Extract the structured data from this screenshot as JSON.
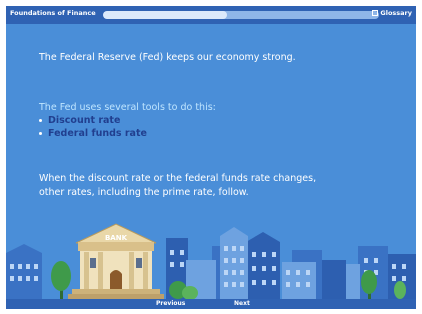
{
  "header": {
    "app_title": "Foundations of Finance",
    "glossary_label": "Glossary",
    "progress_percent": 45
  },
  "lesson": {
    "intro": "The Federal Reserve (Fed) keeps our economy strong.",
    "tools_intro": "The Fed uses several tools to do this:",
    "tools": [
      "Discount rate",
      "Federal funds rate"
    ],
    "conclusion": "When the discount rate or the federal funds rate changes, other rates, including the prime rate, follow."
  },
  "illustration": {
    "bank_sign": "BANK"
  },
  "footer": {
    "previous_label": "Previous",
    "next_label": "Next"
  },
  "colors": {
    "background": "#4a8ed8",
    "bar": "#2f62b3",
    "accent_text": "#bfe5ff",
    "tool_text": "#213f8f"
  }
}
